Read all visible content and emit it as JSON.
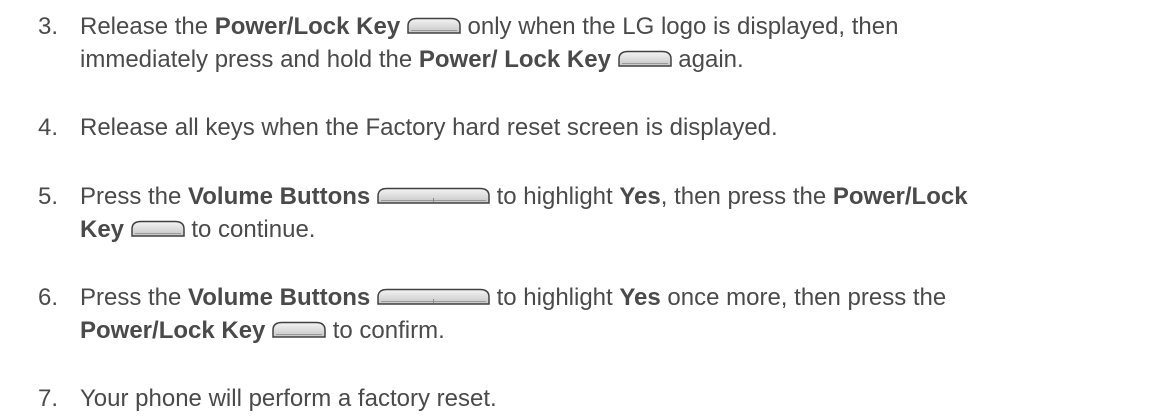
{
  "steps": [
    {
      "number": "3.",
      "line1": {
        "t1": "Release the ",
        "b1": "Power/Lock Key",
        "icon1": "power-lock-key-icon",
        "t2": " only when the LG logo is displayed, then"
      },
      "line2": {
        "t1": "immediately press and hold the ",
        "b1": "Power/ Lock Key",
        "icon1": "power-lock-key-icon",
        "t2": " again."
      }
    },
    {
      "number": "4.",
      "text": "Release all keys when the Factory hard reset screen is displayed."
    },
    {
      "number": "5.",
      "line1": {
        "t1": "Press the ",
        "b1": "Volume Buttons",
        "icon1": "volume-buttons-icon",
        "t2": " to highlight ",
        "b2": "Yes",
        "t3": ", then press the ",
        "b3": "Power/Lock"
      },
      "line2": {
        "b1": "Key",
        "icon1": "power-lock-key-icon",
        "t1": " to continue."
      }
    },
    {
      "number": "6.",
      "line1": {
        "t1": "Press the ",
        "b1": "Volume Buttons",
        "icon1": "volume-buttons-icon",
        "t2": " to highlight ",
        "b2": "Yes",
        "t3": " once more, then press the"
      },
      "line2": {
        "b1": "Power/Lock Key",
        "icon1": "power-lock-key-icon",
        "t1": " to confirm."
      }
    },
    {
      "number": "7.",
      "text": "Your phone will perform a factory reset."
    }
  ]
}
